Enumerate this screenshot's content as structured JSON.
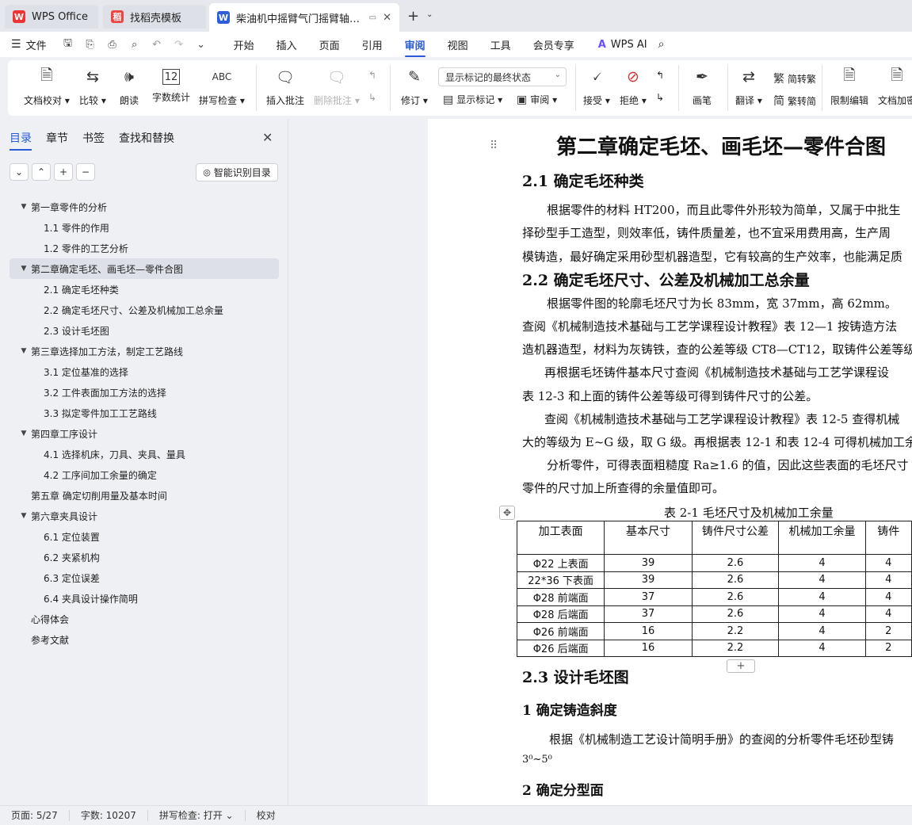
{
  "tabs": [
    {
      "label": "WPS Office"
    },
    {
      "label": "找稻壳模板"
    },
    {
      "label": "柴油机中摇臂气门摇臂轴支座"
    }
  ],
  "menu": {
    "file": "文件",
    "tabs": [
      "开始",
      "插入",
      "页面",
      "引用",
      "审阅",
      "视图",
      "工具",
      "会员专享"
    ],
    "ai": "WPS AI"
  },
  "ribbon": {
    "proof": "文档校对",
    "compare": "比较",
    "read": "朗读",
    "wordcount": "字数统计",
    "spellcheck": "拼写检查",
    "spell_icon_text": "ABC",
    "wordcount_icon_text": "12",
    "insert_comment": "插入批注",
    "delete_comment": "删除批注",
    "revise": "修订",
    "markup_select": "显示标记的最终状态",
    "show_markup": "显示标记",
    "review": "审阅",
    "accept": "接受",
    "reject": "拒绝",
    "pen": "画笔",
    "translate": "翻译",
    "to_traditional": "简转繁",
    "to_simplified": "繁转简",
    "restrict": "限制编辑",
    "doc_encrypt": "文档加密"
  },
  "nav": {
    "tabs": [
      "目录",
      "章节",
      "书签",
      "查找和替换"
    ],
    "smart_toc": "智能识别目录",
    "items": [
      {
        "label": "第一章零件的分析",
        "level": 1
      },
      {
        "label": "1.1 零件的作用",
        "level": 2
      },
      {
        "label": "1.2 零件的工艺分析",
        "level": 2
      },
      {
        "label": "第二章确定毛坯、画毛坯—零件合图",
        "level": 1
      },
      {
        "label": "2.1 确定毛坯种类",
        "level": 2
      },
      {
        "label": "2.2 确定毛坯尺寸、公差及机械加工总余量",
        "level": 2
      },
      {
        "label": "2.3 设计毛坯图",
        "level": 2
      },
      {
        "label": "第三章选择加工方法，制定工艺路线",
        "level": 1
      },
      {
        "label": "3.1 定位基准的选择",
        "level": 2
      },
      {
        "label": "3.2 工件表面加工方法的选择",
        "level": 2
      },
      {
        "label": "3.3 拟定零件加工工艺路线",
        "level": 2
      },
      {
        "label": "第四章工序设计",
        "level": 1
      },
      {
        "label": "4.1 选择机床，刀具、夹具、量具",
        "level": 2
      },
      {
        "label": "4.2 工序间加工余量的确定",
        "level": 2
      },
      {
        "label": "第五章   确定切削用量及基本时间",
        "level": 1
      },
      {
        "label": "第六章夹具设计",
        "level": 1
      },
      {
        "label": "6.1 定位装置",
        "level": 2
      },
      {
        "label": "6.2 夹紧机构",
        "level": 2
      },
      {
        "label": "6.3 定位误差",
        "level": 2
      },
      {
        "label": "6.4 夹具设计操作简明",
        "level": 2
      },
      {
        "label": "心得体会",
        "level": 1
      },
      {
        "label": "参考文献",
        "level": 1
      }
    ]
  },
  "doc": {
    "h1": "第二章确定毛坯、画毛坯—零件合图",
    "h2_1": "2.1 确定毛坯种类",
    "p1": "根据零件的材料 HT200，而且此零件外形较为简单，又属于中批生",
    "p2": "择砂型手工造型，则效率低，铸件质量差，也不宜采用费用高，生产周",
    "p3": "模铸造，最好确定采用砂型机器造型，它有较高的生产效率，也能满足质",
    "h2_2": "2.2 确定毛坯尺寸、公差及机械加工总余量",
    "p4": "根据零件图的轮廓毛坯尺寸为长 83mm，宽 37mm，高 62mm。",
    "p5": "查阅《机械制造技术基础与工艺学课程设计教程》表 12—1 按铸造方法",
    "p6": "造机器造型，材料为灰铸铁，查的公差等级 CT8—CT12，取铸件公差等级",
    "p7": "再根据毛坯铸件基本尺寸查阅《机械制造技术基础与工艺学课程设",
    "p8": "表 12-3 和上面的铸件公差等级可得到铸件尺寸的公差。",
    "p9": "查阅《机械制造技术基础与工艺学课程设计教程》表 12-5 查得机械",
    "p10": "大的等级为 E~G 级，取 G 级。再根据表 12-1 和表 12-4 可得机械加工余",
    "p11": "分析零件，可得表面粗糙度 Ra≥1.6 的值，因此这些表面的毛坯尺寸",
    "p12": "零件的尺寸加上所查得的余量值即可。",
    "table_caption": "表 2-1 毛坯尺寸及机械加工余量",
    "table_headers": [
      "加工表面",
      "基本尺寸",
      "铸件尺寸公差",
      "机械加工余量",
      "铸件"
    ],
    "table_rows": [
      [
        "Φ22 上表面",
        "39",
        "2.6",
        "4",
        "4"
      ],
      [
        "22*36 下表面",
        "39",
        "2.6",
        "4",
        "4"
      ],
      [
        "Φ28 前端面",
        "37",
        "2.6",
        "4",
        "4"
      ],
      [
        "Φ28 后端面",
        "37",
        "2.6",
        "4",
        "4"
      ],
      [
        "Φ26 前端面",
        "16",
        "2.2",
        "4",
        "2"
      ],
      [
        "Φ26 后端面",
        "16",
        "2.2",
        "4",
        "2"
      ]
    ],
    "h2_3": "2.3 设计毛坯图",
    "h3_1": "1 确定铸造斜度",
    "p13": "根据《机械制造工艺设计简明手册》的查阅的分析零件毛坯砂型铸",
    "p14": "3⁰~5⁰",
    "h3_2": "2 确定分型面"
  },
  "status": {
    "page": "页面: 5/27",
    "words": "字数: 10207",
    "spell": "拼写检查: 打开",
    "proof": "校对"
  }
}
